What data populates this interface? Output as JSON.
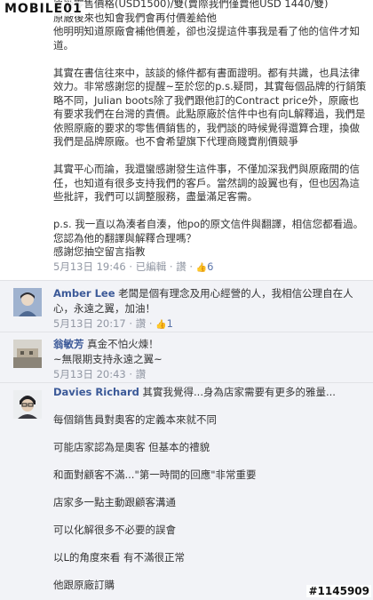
{
  "watermark": {
    "logo_text": "MOBILE01",
    "id_text": "#1145909"
  },
  "first_reply": {
    "paragraphs": [
      "原廠零售價格(USD1500)/雙(賣際我們僅賣他USD 1440/雙)\n原廠後來也知會我們會再付價差給他\n他明明知道原廠會補他價差，卻也沒提這件事我是看了他的信件才知道。",
      "其實在書信往來中，該談的條件都有書面證明。都有共識，也具法律效力。非常感謝您的提醒~至於您的p.s.疑問，其實每個品牌的行銷策略不同，Julian boots除了我們跟他訂的Contract price外，原廠也有要求我們在台灣的責價。此點原廠於信件中也有向L解釋過，我們是依照原廠的要求的零售價銷售的，我們談的時候覺得還算合理，換做我們是品牌原廠。也不會希望旗下代理商賤賣削價競爭",
      "其實平心而論，我還蠻感謝發生這件事，不僅加深我們與原廠間的信任，也知道有很多支持我們的客戶。當然調的設翼也有，但也因為這些批評，我們可以調整服務，盡量滿足客需。",
      "p.s. 我一直以為湊者自湊，他po的原文信件與翻譯，相信您都看過。您認為他的翻譯與解釋合理嗎？\n感謝您抽空留言指教"
    ],
    "meta": {
      "date": "5月13日 19:46",
      "separator": "·",
      "edited": "已編輯",
      "like": "讚",
      "like_count": "6"
    }
  },
  "comments": [
    {
      "author": "Amber Lee",
      "text": " 老闆是個有理念及用心經營的人，我相信公理自在人心，永遠之翼，加油！",
      "meta": {
        "date": "5月13日 20:17",
        "separator": "·",
        "like": "讚",
        "like_count": "1"
      },
      "avatar_color": "#8aa1c2"
    },
    {
      "author": "翁敏芳",
      "text": " 真金不怕火煉！\n~無限期支持永遠之翼~",
      "meta": {
        "date": "5月13日 20:43",
        "separator": "·",
        "like": "讚"
      },
      "avatar_color": "#a9a39a"
    },
    {
      "author": "Davies Richard",
      "text": " 其實我覺得...身為店家需要有更多的雅量...",
      "paragraphs": [
        "每個銷售員對奧客的定義本來就不同",
        "可能店家認為是奧客 但基本的禮貌",
        "和面對顧客不滿...\"第一時間的回應\"非常重要",
        "店家多一點主動跟顧客溝通",
        "可以化解很多不必要的誤會",
        "以L的角度來看 有不滿很正常",
        "他跟原廠訂購"
      ],
      "avatar_color": "#c9cbce"
    }
  ]
}
